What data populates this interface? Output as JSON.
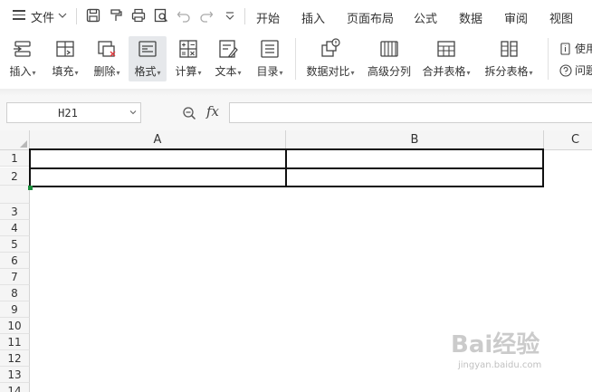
{
  "menubar": {
    "file_label": "文件",
    "tabs": [
      "开始",
      "插入",
      "页面布局",
      "公式",
      "数据",
      "审阅",
      "视图"
    ]
  },
  "ribbon": {
    "buttons": [
      {
        "label": "插入",
        "has_caret": true,
        "icon": "insert-rows-icon"
      },
      {
        "label": "填充",
        "has_caret": true,
        "icon": "fill-icon"
      },
      {
        "label": "删除",
        "has_caret": true,
        "icon": "delete-icon"
      },
      {
        "label": "格式",
        "has_caret": true,
        "icon": "format-icon",
        "active": true
      },
      {
        "label": "计算",
        "has_caret": true,
        "icon": "calculate-icon"
      },
      {
        "label": "文本",
        "has_caret": true,
        "icon": "text-icon"
      },
      {
        "label": "目录",
        "has_caret": true,
        "icon": "toc-icon"
      },
      {
        "label": "数据对比",
        "has_caret": true,
        "icon": "data-compare-icon"
      },
      {
        "label": "高级分列",
        "has_caret": false,
        "icon": "split-columns-icon"
      },
      {
        "label": "合并表格",
        "has_caret": true,
        "icon": "merge-tables-icon"
      },
      {
        "label": "拆分表格",
        "has_caret": true,
        "icon": "split-tables-icon"
      }
    ],
    "side_items": [
      "使用",
      "问题"
    ]
  },
  "formula_bar": {
    "name_box_value": "H21",
    "fx_label": "fx",
    "formula_value": ""
  },
  "sheet": {
    "columns": [
      "A",
      "B",
      "C"
    ],
    "rows": [
      "1",
      "2",
      "3",
      "4",
      "5",
      "6",
      "7",
      "8",
      "9",
      "10",
      "11",
      "12",
      "13",
      "14"
    ]
  },
  "watermark": {
    "brand": "Bai经验",
    "url": "jingyan.baidu.com"
  },
  "colors": {
    "border_dark": "#111111",
    "header_bg": "#f5f5f5",
    "selection_green": "#1a8f3c"
  }
}
